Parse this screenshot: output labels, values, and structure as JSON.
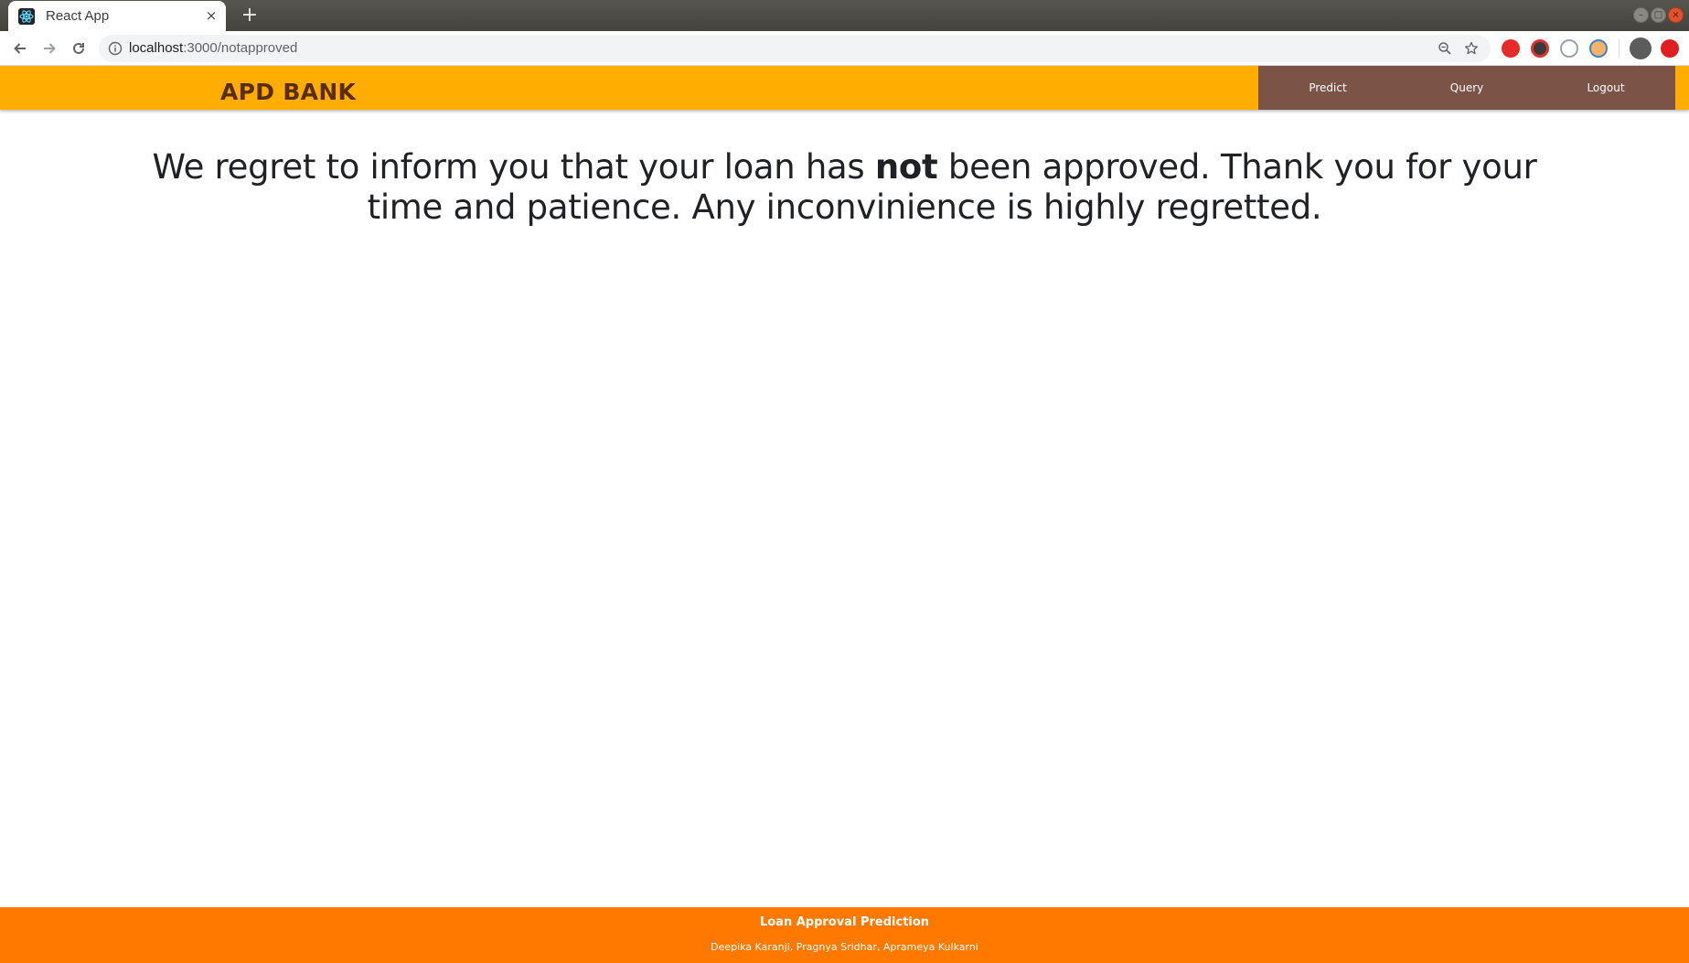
{
  "browser": {
    "tab_title": "React App",
    "tab_close_glyph": "×",
    "new_tab_glyph": "+",
    "url_host": "localhost",
    "url_path": ":3000/notapproved",
    "tab_favicon": "react-logo-icon",
    "window_controls": {
      "minimize": "–",
      "maximize": "□",
      "close": "×"
    },
    "accent_color": "#ffffff",
    "chrome_color": "#4d4b46"
  },
  "header": {
    "brand": "APD BANK",
    "nav": [
      {
        "label": "Predict"
      },
      {
        "label": "Query"
      },
      {
        "label": "Logout"
      }
    ],
    "bar_color": "#ffad00",
    "nav_bg_color": "#7b5347",
    "brand_color": "#5a2d12"
  },
  "main": {
    "message_before": "We regret to inform you that your loan has ",
    "message_bold": "not",
    "message_after": " been approved. Thank you for your time and patience. Any inconvinience is highly regretted."
  },
  "footer": {
    "title": "Loan Approval Prediction",
    "authors": "Deepika Karanji, Pragnya Sridhar, Aprameya Kulkarni",
    "bg_color": "#ff7800"
  }
}
